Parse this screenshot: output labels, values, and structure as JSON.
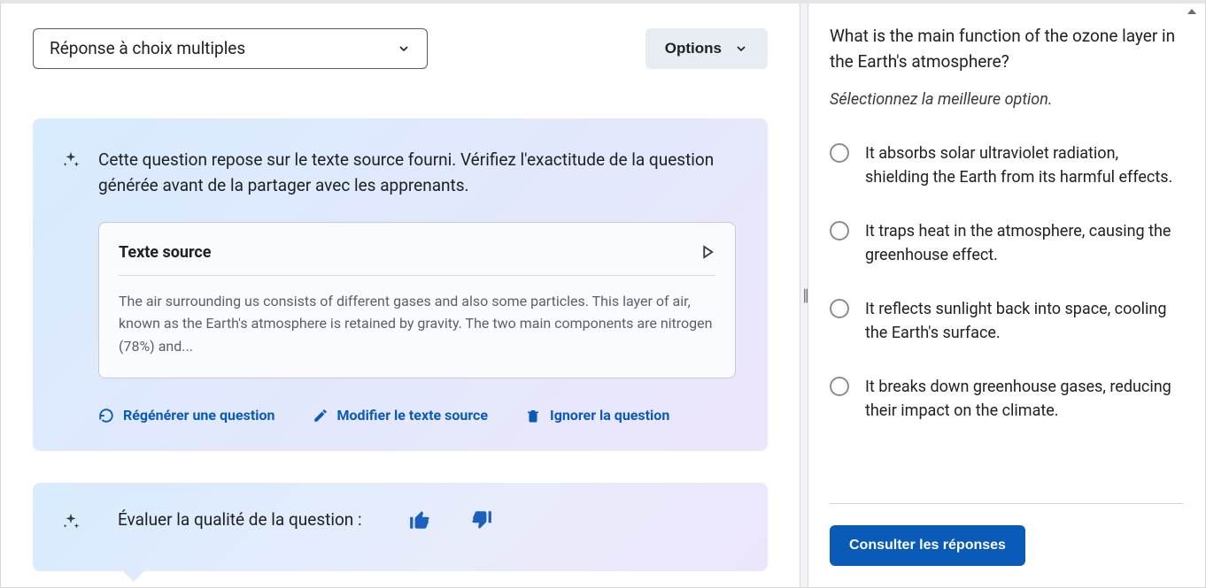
{
  "left": {
    "question_type_label": "Réponse à choix multiples",
    "options_label": "Options",
    "info_message": "Cette question repose sur le texte source fourni. Vérifiez l'exactitude de la question générée avant de la partager avec les apprenants.",
    "source_title": "Texte source",
    "source_body": "The air surrounding us consists of different gases and also some particles. This layer of air, known as the Earth's atmosphere is retained by gravity. The two main components are nitrogen (78%) and...",
    "actions": {
      "regenerate": "Régénérer une question",
      "modify": "Modifier le texte source",
      "ignore": "Ignorer la question"
    },
    "rate_label": "Évaluer la qualité de la question :"
  },
  "right": {
    "question": "What is the main function of the ozone layer in the Earth's atmosphere?",
    "instruction": "Sélectionnez la meilleure option.",
    "options": [
      "It absorbs solar ultraviolet radiation, shielding the Earth from its harmful effects.",
      "It traps heat in the atmosphere, causing the greenhouse effect.",
      "It reflects sunlight back into space, cooling the Earth's surface.",
      "It breaks down greenhouse gases, reducing their impact on the climate."
    ],
    "consult_label": "Consulter les réponses"
  }
}
